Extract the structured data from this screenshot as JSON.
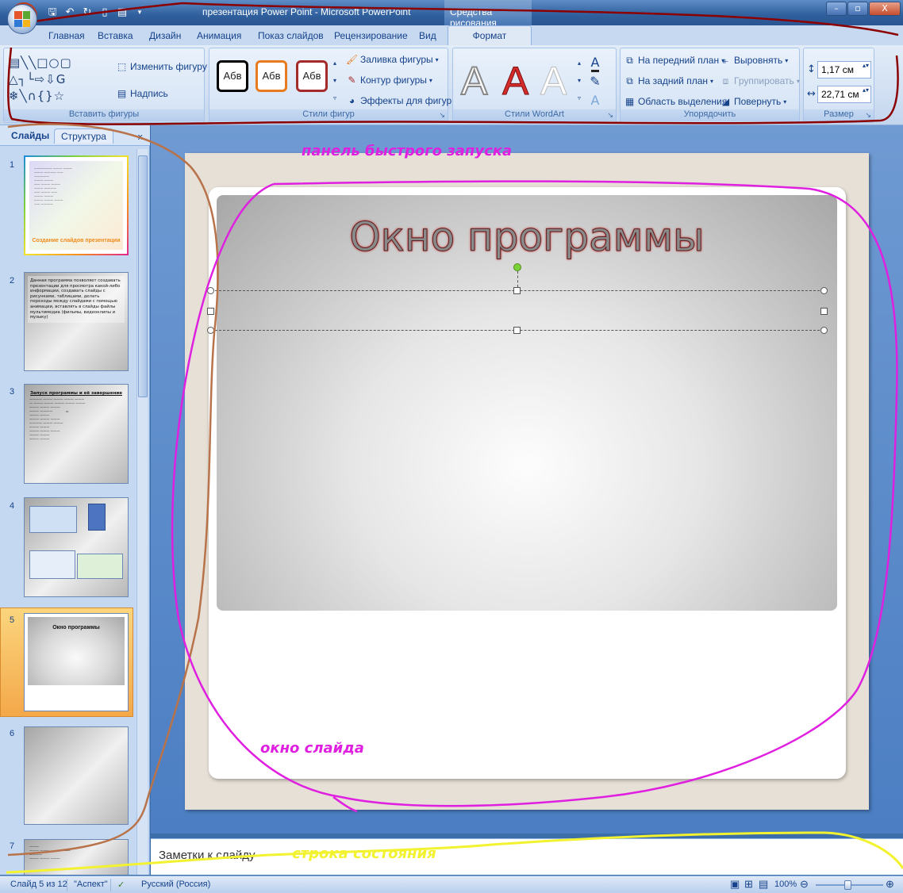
{
  "window": {
    "title": "презентация Power Point - Microsoft PowerPoint",
    "context_tab_group": "Средства рисования"
  },
  "quick_access": [
    "save-icon",
    "undo-icon",
    "redo-icon",
    "new-icon",
    "open-icon"
  ],
  "ribbon_tabs": [
    "Главная",
    "Вставка",
    "Дизайн",
    "Анимация",
    "Показ слайдов",
    "Рецензирование",
    "Вид",
    "Формат"
  ],
  "active_tab": "Формат",
  "ribbon": {
    "insert_shapes": {
      "label": "Вставить фигуры",
      "change_shape": "Изменить фигуру",
      "text_box": "Надпись"
    },
    "shape_styles": {
      "label": "Стили фигур",
      "swatch_text": "Абв",
      "fill": "Заливка фигуры",
      "outline": "Контур фигуры",
      "effects": "Эффекты для фигур",
      "swatch_colors": [
        "#000000",
        "#e87b1e",
        "#a52a2a"
      ]
    },
    "wordart_styles": {
      "label": "Стили WordArt",
      "letter": "A"
    },
    "arrange": {
      "label": "Упорядочить",
      "bring_front": "На передний план",
      "send_back": "На задний план",
      "selection_pane": "Область выделения",
      "align": "Выровнять",
      "group": "Группировать",
      "rotate": "Повернуть"
    },
    "size": {
      "label": "Размер",
      "height": "1,17 см",
      "width": "22,71 см"
    }
  },
  "slides_panel": {
    "tab_slides": "Слайды",
    "tab_outline": "Структура",
    "close": "x",
    "slides": [
      {
        "num": "1",
        "caption": "Создание слайдов презентации"
      },
      {
        "num": "2",
        "text": "Данная программа позволяет создавать презентации для просмотра какой-либо информации, создавать слайды с рисунками, таблицами, делать переходы между слайдами с помощью анимации, вставлять в слайды файлы мультимедиа (фильмы, видеоклипы и музыку)"
      },
      {
        "num": "3",
        "heading": "Запуск программы и её завершение"
      },
      {
        "num": "4"
      },
      {
        "num": "5",
        "title": "Окно программы"
      },
      {
        "num": "6"
      },
      {
        "num": "7"
      }
    ]
  },
  "slide": {
    "title": "Окно программы"
  },
  "notes": {
    "placeholder": "Заметки к слайду"
  },
  "status_bar": {
    "slide_counter": "Слайд 5 из 12",
    "theme": "\"Аспект\"",
    "language": "Русский (Россия)",
    "zoom": "100%"
  },
  "annotations": {
    "quick_launch": "панель быстрого запуска",
    "slide_window": "окно слайда",
    "status_line": "строка состояния",
    "colors": {
      "magenta": "#e020e0",
      "yellow": "#f2f230",
      "brown": "#b8734a",
      "red": "#8b0000"
    }
  }
}
